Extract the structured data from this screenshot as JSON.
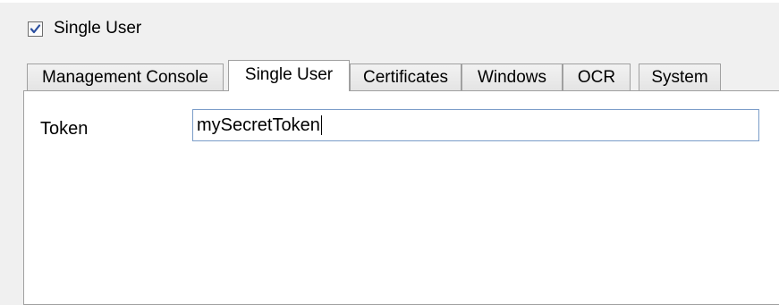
{
  "single_user_checkbox": {
    "label": "Single User",
    "checked": true
  },
  "tabs": [
    {
      "label": "Management Console",
      "active": false
    },
    {
      "label": "Single User",
      "active": true
    },
    {
      "label": "Certificates",
      "active": false
    },
    {
      "label": "Windows",
      "active": false
    },
    {
      "label": "OCR",
      "active": false
    },
    {
      "label": "System",
      "active": false
    }
  ],
  "single_user_tab": {
    "token_label": "Token",
    "token_value": "mySecretToken"
  },
  "colors": {
    "window_bg": "#f0f0f0",
    "panel_bg": "#ffffff",
    "border": "#a0a0a0",
    "input_focus_border": "#7a9cc8",
    "check_mark": "#2b4fa0"
  },
  "icons": {
    "checkbox": "check-mark-icon"
  }
}
